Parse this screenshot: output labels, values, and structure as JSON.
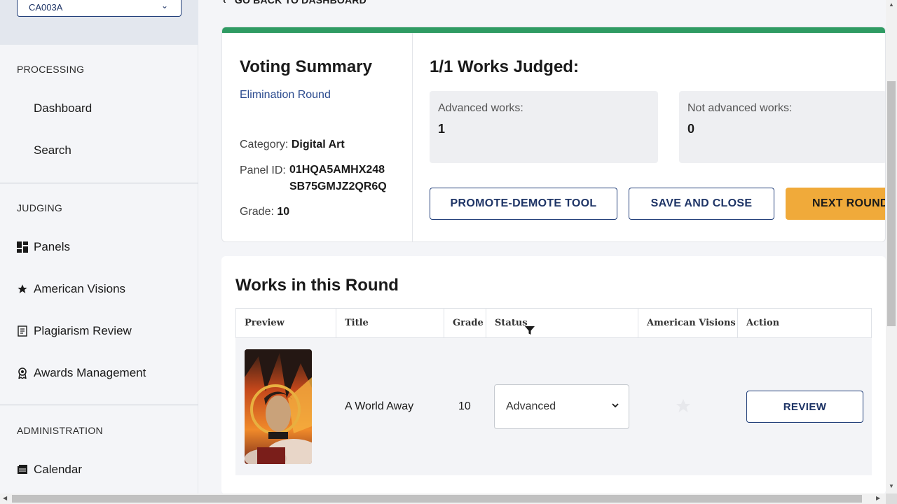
{
  "sidebar": {
    "org_select": {
      "value": "CA003A"
    },
    "sections": {
      "processing": "PROCESSING",
      "judging": "JUDGING",
      "administration": "ADMINISTRATION"
    },
    "processing_items": [
      {
        "label": "Dashboard"
      },
      {
        "label": "Search"
      }
    ],
    "judging_items": [
      {
        "label": "Panels",
        "icon": "grid-icon"
      },
      {
        "label": "American Visions",
        "icon": "star-icon"
      },
      {
        "label": "Plagiarism Review",
        "icon": "document-icon"
      },
      {
        "label": "Awards Management",
        "icon": "award-icon"
      }
    ],
    "administration_items": [
      {
        "label": "Calendar",
        "icon": "calendar-icon"
      }
    ]
  },
  "main": {
    "back_link": "GO BACK TO DASHBOARD",
    "summary": {
      "title": "Voting Summary",
      "round": "Elimination Round",
      "category_label": "Category:",
      "category_value": "Digital Art",
      "panel_id_label": "Panel ID:",
      "panel_id_value": "01HQA5AMHX248 SB75GMJZ2QR6Q",
      "grade_label": "Grade:",
      "grade_value": "10",
      "judged_title": "1/1 Works Judged:",
      "advanced_label": "Advanced works:",
      "advanced_value": "1",
      "not_advanced_label": "Not advanced works:",
      "not_advanced_value": "0",
      "buttons": {
        "promote_demote": "PROMOTE-DEMOTE TOOL",
        "save_close": "SAVE AND CLOSE",
        "next_round": "NEXT ROUND"
      }
    },
    "works": {
      "title": "Works in this Round",
      "columns": [
        "Preview",
        "Title",
        "Grade",
        "Status",
        "American Visions",
        "Action"
      ],
      "rows": [
        {
          "title": "A World Away",
          "grade": "10",
          "status": "Advanced",
          "american_visions": false,
          "action": "REVIEW"
        }
      ]
    }
  },
  "colors": {
    "accent_navy": "#1e3466",
    "progress_green": "#2f9b63",
    "next_round_orange": "#f0aa3a"
  }
}
